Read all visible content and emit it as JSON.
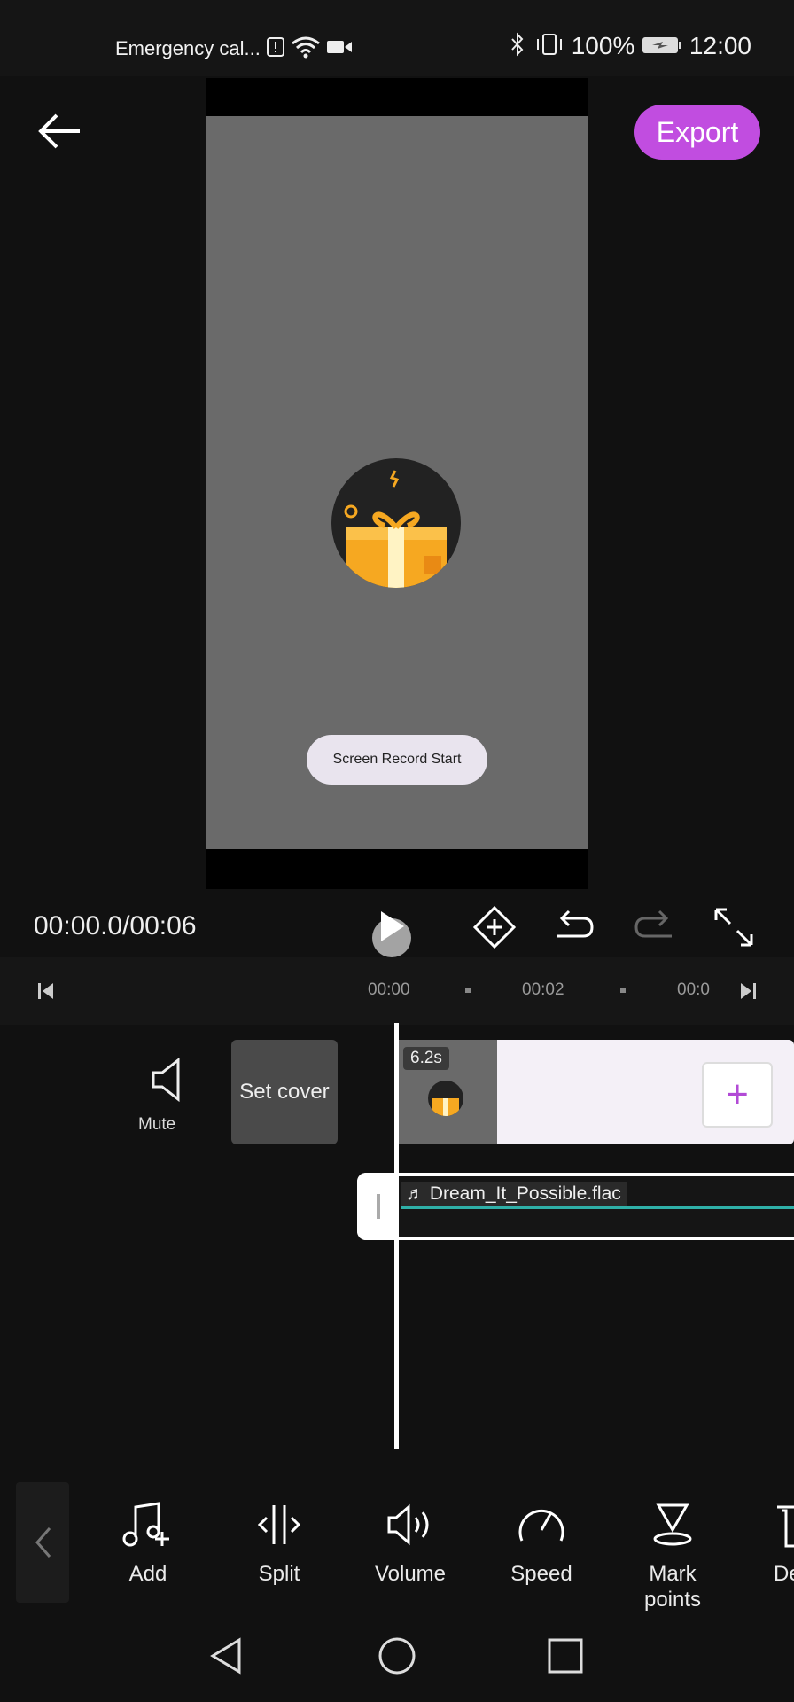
{
  "status_bar": {
    "left_text": "Emergency cal...",
    "battery": "100%",
    "time": "12:00",
    "icons": [
      "alert-icon",
      "wifi-icon",
      "video-icon",
      "bluetooth-icon",
      "vibrate-icon",
      "battery-icon"
    ]
  },
  "header": {
    "export_label": "Export"
  },
  "preview": {
    "pill_text": "Screen Record Start"
  },
  "playback": {
    "time_display": "00:00.0/00:06",
    "controls": [
      "play-icon",
      "keyframe-icon",
      "undo-icon",
      "redo-icon",
      "fullscreen-icon"
    ]
  },
  "ruler": {
    "ticks": [
      "00:00",
      "00:02",
      "00:0"
    ]
  },
  "tracks": {
    "mute_label": "Mute",
    "set_cover_label": "Set cover",
    "clip_duration": "6.2s",
    "add_clip_symbol": "+",
    "audio_name": "Dream_It_Possible.flac"
  },
  "tools": [
    {
      "label": "Add",
      "icon": "music-add-icon"
    },
    {
      "label": "Split",
      "icon": "split-icon"
    },
    {
      "label": "Volume",
      "icon": "volume-icon"
    },
    {
      "label": "Speed",
      "icon": "speed-icon"
    },
    {
      "label": "Mark\npoints",
      "icon": "mark-points-icon"
    },
    {
      "label": "De",
      "icon": "delete-icon"
    }
  ],
  "colors": {
    "accent": "#c14de0",
    "waveform": "#2fb0a8",
    "background": "#111111"
  }
}
